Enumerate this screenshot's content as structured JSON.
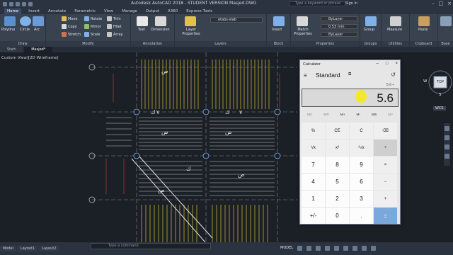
{
  "window": {
    "title": "Autodesk AutoCAD 2018 - STUDENT VERSION    Masjed.DWG",
    "search_placeholder": "Type a keyword or phrase",
    "signin": "Sign In"
  },
  "tabs": [
    "Home",
    "Insert",
    "Annotate",
    "Parametric",
    "View",
    "Manage",
    "Output",
    "A360",
    "Express Tools"
  ],
  "ribbon": {
    "draw": {
      "label": "Draw",
      "tools": [
        "Polyline",
        "Circle",
        "Arc"
      ]
    },
    "modify": {
      "label": "Modify",
      "tools": [
        "Move",
        "Rotate",
        "Trim",
        "Copy",
        "Mirror",
        "Fillet",
        "Stretch",
        "Scale",
        "Array"
      ]
    },
    "annotation": {
      "label": "Annotation",
      "tools": [
        "Text",
        "Dimension"
      ]
    },
    "layers": {
      "label": "Layers",
      "tools": [
        "Layer Properties"
      ],
      "current_layer": "etabs-slab"
    },
    "block": {
      "label": "Block",
      "tools": [
        "Insert"
      ]
    },
    "properties": {
      "label": "Properties",
      "tools": [
        "Match Properties"
      ],
      "values": [
        "ByLayer",
        "0.53 mm",
        "ByLayer"
      ]
    },
    "groups": {
      "label": "Groups",
      "tools": [
        "Group"
      ]
    },
    "utilities": {
      "label": "Utilities",
      "tools": [
        "Measure"
      ]
    },
    "clipboard": {
      "label": "Clipboard",
      "tools": [
        "Paste"
      ]
    },
    "base": {
      "label": "Base"
    }
  },
  "file_tabs": [
    "Start",
    "Masjed*"
  ],
  "viewport_label": "Custom View][2D Wireframe]",
  "calculator": {
    "title": "Calculator",
    "mode": "Standard",
    "expression": "5.6 ÷",
    "display": "5.6",
    "memory": [
      "MC",
      "MR",
      "M+",
      "M-",
      "MS",
      "M˅"
    ],
    "memory_enabled": [
      false,
      false,
      true,
      true,
      true,
      false
    ],
    "keys": [
      "%",
      "CE",
      "C",
      "⌫",
      "¹/x",
      "x²",
      "²√x",
      "÷",
      "7",
      "8",
      "9",
      "×",
      "4",
      "5",
      "6",
      "−",
      "1",
      "2",
      "3",
      "+",
      "+/-",
      "0",
      ".",
      "="
    ]
  },
  "canvas_text": {
    "arabic_k": "ك",
    "arabic_7": "٧",
    "arabic_s": "ص",
    "compass_top": "TOP",
    "compass_w": "W",
    "compass_s": "S",
    "wcs": "WCS"
  },
  "statusbar": {
    "command_placeholder": "Type a command",
    "layout_tabs": [
      "Model",
      "Layout1",
      "Layout2"
    ],
    "model": "MODEL"
  }
}
